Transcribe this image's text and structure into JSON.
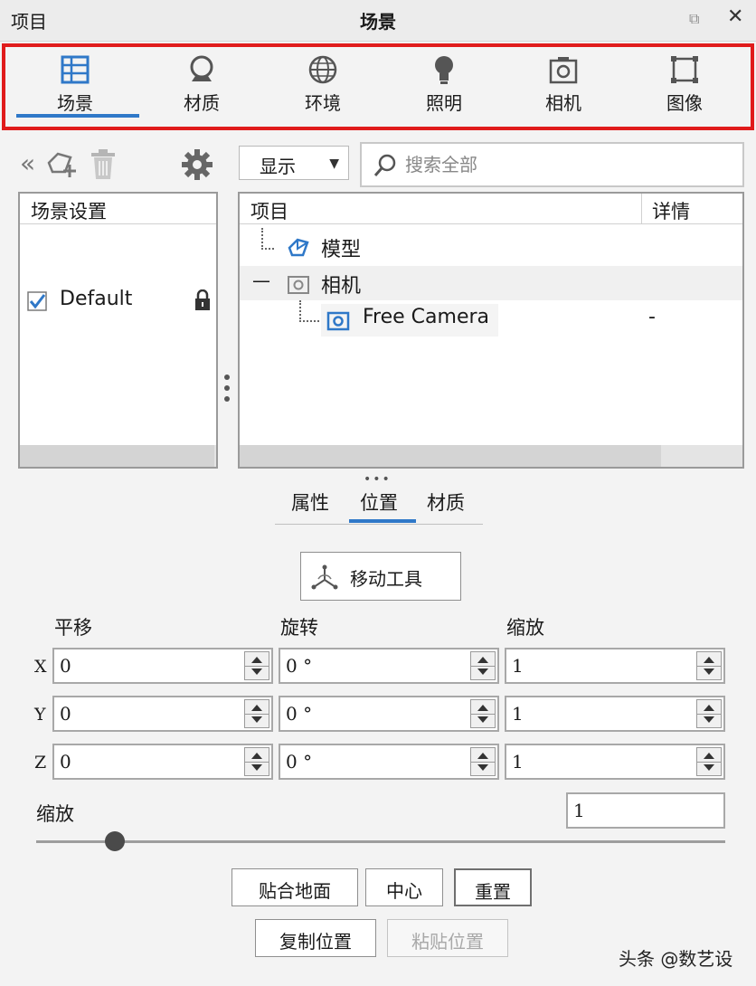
{
  "titlebar": {
    "left": "项目",
    "center": "场景",
    "restore_glyph": "⧉",
    "close_glyph": "✕"
  },
  "tabs": [
    {
      "label": "场景",
      "icon": "scene-grid-icon"
    },
    {
      "label": "材质",
      "icon": "material-ball-icon"
    },
    {
      "label": "环境",
      "icon": "globe-icon"
    },
    {
      "label": "照明",
      "icon": "bulb-icon"
    },
    {
      "label": "相机",
      "icon": "camera-icon"
    },
    {
      "label": "图像",
      "icon": "image-frame-icon"
    }
  ],
  "toolbar": {
    "collapse_glyph": "«",
    "display_select": "显示",
    "search_placeholder": "搜索全部"
  },
  "scene_settings": {
    "header": "场景设置",
    "items": [
      {
        "label": "Default",
        "checked": true
      }
    ]
  },
  "tree": {
    "header_item": "项目",
    "header_detail": "详情",
    "rows": [
      {
        "label": "模型",
        "detail": ""
      },
      {
        "label": "相机",
        "detail": "",
        "expander": "—"
      },
      {
        "label": "Free Camera",
        "detail": "-"
      }
    ]
  },
  "subtabs": {
    "grip": "•••",
    "items": [
      "属性",
      "位置",
      "材质"
    ],
    "active": "位置"
  },
  "move_tool": "移动工具",
  "transform": {
    "translate_label": "平移",
    "rotate_label": "旋转",
    "scale_label": "缩放",
    "rows": [
      {
        "axis": "X",
        "translate": "0",
        "rotate": "0 °",
        "scale": "1"
      },
      {
        "axis": "Y",
        "translate": "0",
        "rotate": "0 °",
        "scale": "1"
      },
      {
        "axis": "Z",
        "translate": "0",
        "rotate": "0 °",
        "scale": "1"
      }
    ]
  },
  "uniform_scale": {
    "label": "缩放",
    "value": "1",
    "slider_fraction": 0.11
  },
  "buttons": {
    "snap_to_ground": "贴合地面",
    "center": "中心",
    "reset": "重置",
    "copy_position": "复制位置",
    "paste_position": "粘贴位置"
  },
  "watermark": "头条 @数艺设",
  "colors": {
    "accent": "#2f78c8",
    "highlight_border": "#e01b1b"
  }
}
